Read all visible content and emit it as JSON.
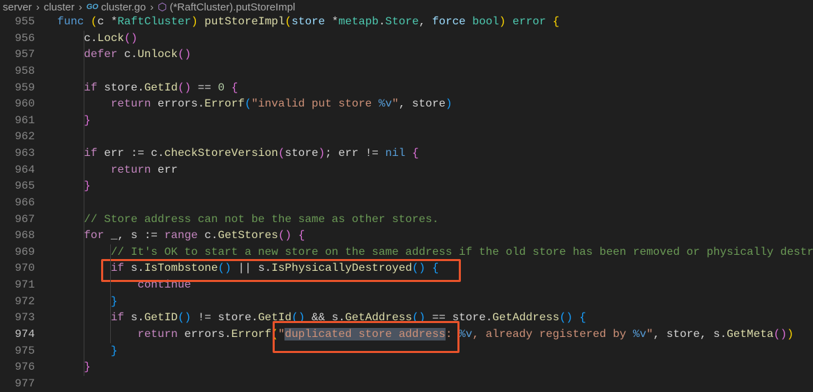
{
  "breadcrumb": {
    "items": [
      "server",
      "cluster",
      "cluster.go",
      "(*RaftCluster).putStoreImpl"
    ],
    "go_badge": "GO"
  },
  "editor": {
    "active_line": "974",
    "lines": [
      {
        "n": "955",
        "t": [
          [
            "func",
            "k"
          ],
          [
            " ",
            "p"
          ],
          [
            "(",
            "b1"
          ],
          [
            "c ",
            "p"
          ],
          [
            "*",
            "p"
          ],
          [
            "RaftCluster",
            "t"
          ],
          [
            ")",
            "b1"
          ],
          [
            " ",
            "p"
          ],
          [
            "putStoreImpl",
            "f"
          ],
          [
            "(",
            "b1"
          ],
          [
            "store ",
            "v"
          ],
          [
            "*",
            "p"
          ],
          [
            "metapb",
            "t"
          ],
          [
            ".",
            "p"
          ],
          [
            "Store",
            "t"
          ],
          [
            ", ",
            "p"
          ],
          [
            "force ",
            "v"
          ],
          [
            "bool",
            "t"
          ],
          [
            ")",
            "b1"
          ],
          [
            " ",
            "p"
          ],
          [
            "error",
            "t"
          ],
          [
            " ",
            "p"
          ],
          [
            "{",
            "b1"
          ]
        ]
      },
      {
        "n": "956",
        "t": [
          [
            "    c.",
            "p"
          ],
          [
            "Lock",
            "f"
          ],
          [
            "(",
            "b2"
          ],
          [
            ")",
            "b2"
          ]
        ]
      },
      {
        "n": "957",
        "t": [
          [
            "    ",
            "p"
          ],
          [
            "defer",
            "c"
          ],
          [
            " c.",
            "p"
          ],
          [
            "Unlock",
            "f"
          ],
          [
            "(",
            "b2"
          ],
          [
            ")",
            "b2"
          ]
        ]
      },
      {
        "n": "958",
        "t": []
      },
      {
        "n": "959",
        "t": [
          [
            "    ",
            "p"
          ],
          [
            "if",
            "c"
          ],
          [
            " store.",
            "p"
          ],
          [
            "GetId",
            "f"
          ],
          [
            "(",
            "b2"
          ],
          [
            ")",
            "b2"
          ],
          [
            " == ",
            "p"
          ],
          [
            "0",
            "n"
          ],
          [
            " ",
            "p"
          ],
          [
            "{",
            "b2"
          ]
        ]
      },
      {
        "n": "960",
        "t": [
          [
            "        ",
            "p"
          ],
          [
            "return",
            "c"
          ],
          [
            " errors.",
            "p"
          ],
          [
            "Errorf",
            "f"
          ],
          [
            "(",
            "b3"
          ],
          [
            "\"invalid put store ",
            "s"
          ],
          [
            "%v",
            "e"
          ],
          [
            "\"",
            "s"
          ],
          [
            ", store",
            "p"
          ],
          [
            ")",
            "b3"
          ]
        ]
      },
      {
        "n": "961",
        "t": [
          [
            "    ",
            "p"
          ],
          [
            "}",
            "b2"
          ]
        ]
      },
      {
        "n": "962",
        "t": []
      },
      {
        "n": "963",
        "t": [
          [
            "    ",
            "p"
          ],
          [
            "if",
            "c"
          ],
          [
            " err := c.",
            "p"
          ],
          [
            "checkStoreVersion",
            "f"
          ],
          [
            "(",
            "b2"
          ],
          [
            "store",
            "p"
          ],
          [
            ")",
            "b2"
          ],
          [
            "; err != ",
            "p"
          ],
          [
            "nil",
            "k"
          ],
          [
            " ",
            "p"
          ],
          [
            "{",
            "b2"
          ]
        ]
      },
      {
        "n": "964",
        "t": [
          [
            "        ",
            "p"
          ],
          [
            "return",
            "c"
          ],
          [
            " err",
            "p"
          ]
        ]
      },
      {
        "n": "965",
        "t": [
          [
            "    ",
            "p"
          ],
          [
            "}",
            "b2"
          ]
        ]
      },
      {
        "n": "966",
        "t": []
      },
      {
        "n": "967",
        "t": [
          [
            "    ",
            "p"
          ],
          [
            "// Store address can not be the same as other stores.",
            "m"
          ]
        ]
      },
      {
        "n": "968",
        "t": [
          [
            "    ",
            "p"
          ],
          [
            "for",
            "c"
          ],
          [
            " _, s := ",
            "p"
          ],
          [
            "range",
            "c"
          ],
          [
            " c.",
            "p"
          ],
          [
            "GetStores",
            "f"
          ],
          [
            "(",
            "b2"
          ],
          [
            ")",
            "b2"
          ],
          [
            " ",
            "p"
          ],
          [
            "{",
            "b2"
          ]
        ]
      },
      {
        "n": "969",
        "t": [
          [
            "        ",
            "p"
          ],
          [
            "// It's OK to start a new store on the same address if the old store has been removed or physically destroyed.",
            "m"
          ]
        ]
      },
      {
        "n": "970",
        "t": [
          [
            "        ",
            "p"
          ],
          [
            "if",
            "c"
          ],
          [
            " s.",
            "p"
          ],
          [
            "IsTombstone",
            "f"
          ],
          [
            "(",
            "b3"
          ],
          [
            ")",
            "b3"
          ],
          [
            " || s.",
            "p"
          ],
          [
            "IsPhysicallyDestroyed",
            "f"
          ],
          [
            "(",
            "b3"
          ],
          [
            ")",
            "b3"
          ],
          [
            " ",
            "p"
          ],
          [
            "{",
            "b3"
          ]
        ]
      },
      {
        "n": "971",
        "t": [
          [
            "            ",
            "p"
          ],
          [
            "continue",
            "c"
          ]
        ]
      },
      {
        "n": "972",
        "t": [
          [
            "        ",
            "p"
          ],
          [
            "}",
            "b3"
          ]
        ]
      },
      {
        "n": "973",
        "t": [
          [
            "        ",
            "p"
          ],
          [
            "if",
            "c"
          ],
          [
            " s.",
            "p"
          ],
          [
            "GetID",
            "f"
          ],
          [
            "(",
            "b3"
          ],
          [
            ")",
            "b3"
          ],
          [
            " != store.",
            "p"
          ],
          [
            "GetId",
            "f"
          ],
          [
            "(",
            "b3"
          ],
          [
            ")",
            "b3"
          ],
          [
            " && s.",
            "p"
          ],
          [
            "GetAddress",
            "f"
          ],
          [
            "(",
            "b3"
          ],
          [
            ")",
            "b3"
          ],
          [
            " == store.",
            "p"
          ],
          [
            "GetAddress",
            "f"
          ],
          [
            "(",
            "b3"
          ],
          [
            ")",
            "b3"
          ],
          [
            " ",
            "p"
          ],
          [
            "{",
            "b3"
          ]
        ]
      },
      {
        "n": "974",
        "t": [
          [
            "            ",
            "p"
          ],
          [
            "return",
            "c"
          ],
          [
            " errors.",
            "p"
          ],
          [
            "Errorf",
            "f"
          ],
          [
            "(",
            "b1"
          ],
          [
            "\"",
            "s"
          ],
          [
            "duplicated store address",
            "s sel"
          ],
          [
            ": ",
            "s"
          ],
          [
            "%v",
            "e"
          ],
          [
            ", already registered by ",
            "s"
          ],
          [
            "%v",
            "e"
          ],
          [
            "\"",
            "s"
          ],
          [
            ", store, s.",
            "p"
          ],
          [
            "GetMeta",
            "f"
          ],
          [
            "(",
            "b2"
          ],
          [
            ")",
            "b2"
          ],
          [
            ")",
            "b1"
          ]
        ]
      },
      {
        "n": "975",
        "t": [
          [
            "        ",
            "p"
          ],
          [
            "}",
            "b3"
          ]
        ]
      },
      {
        "n": "976",
        "t": [
          [
            "    ",
            "p"
          ],
          [
            "}",
            "b2"
          ]
        ]
      },
      {
        "n": "977",
        "t": []
      }
    ]
  }
}
